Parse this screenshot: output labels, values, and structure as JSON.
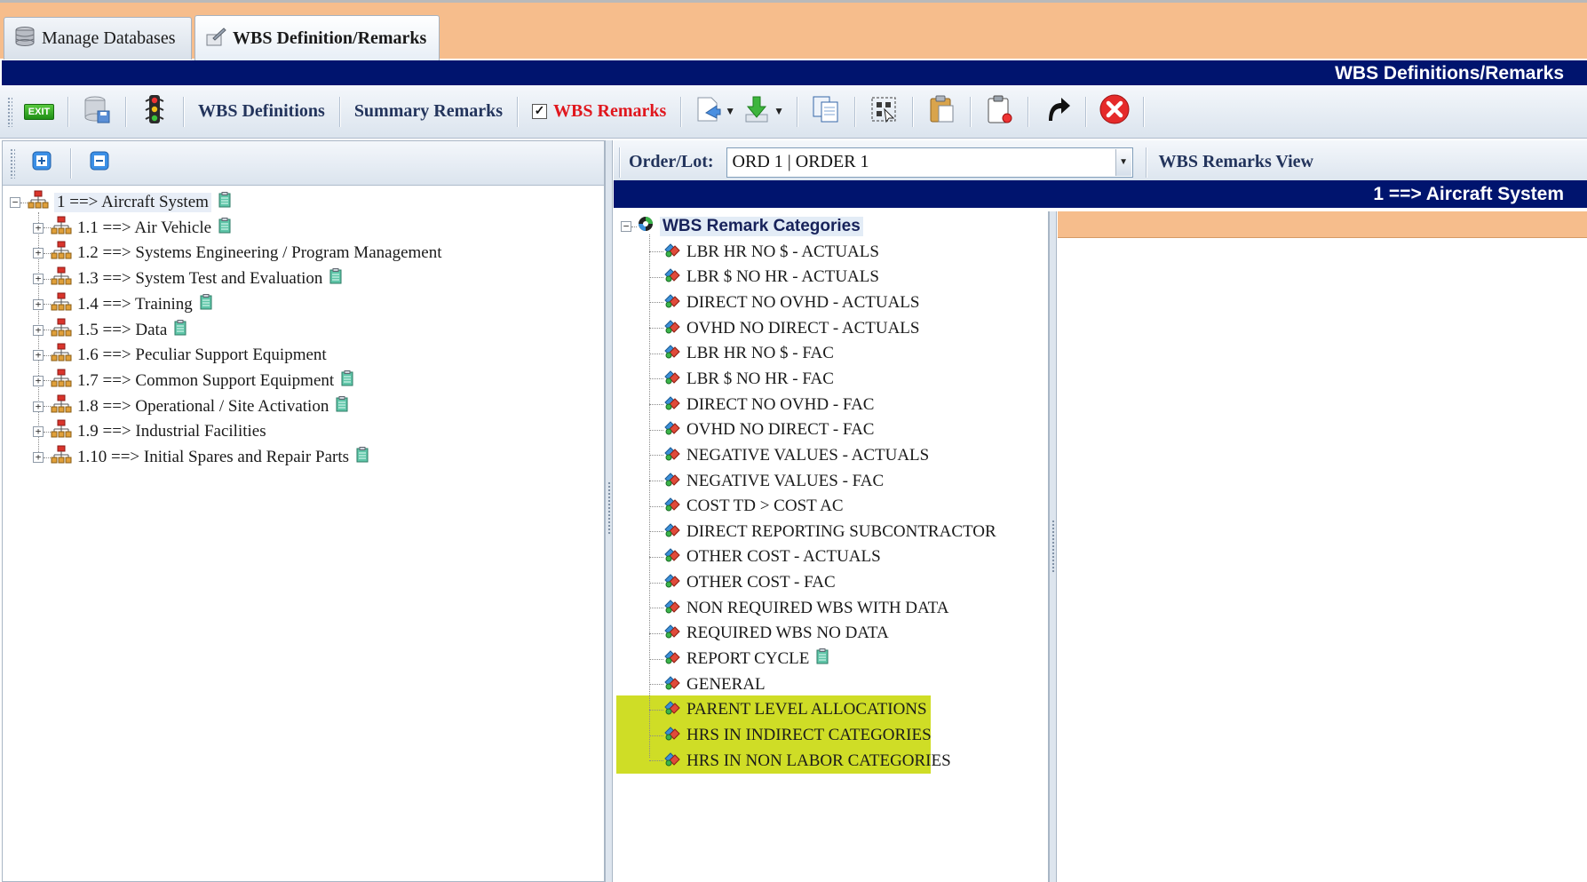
{
  "tabs": [
    {
      "label": "Manage Databases",
      "icon": "database-icon",
      "active": false
    },
    {
      "label": "WBS Definition/Remarks",
      "icon": "edit-document-icon",
      "active": true
    }
  ],
  "title_bar": "WBS Definitions/Remarks",
  "toolbar": {
    "exit_label": "EXIT",
    "wbs_definitions": "WBS Definitions",
    "summary_remarks": "Summary Remarks",
    "wbs_remarks": "WBS Remarks",
    "wbs_remarks_checked": true
  },
  "left_tree": {
    "root": {
      "label": "1 ==> Aircraft System",
      "has_note": true
    },
    "children": [
      {
        "label": "1.1 ==> Air Vehicle",
        "has_note": true
      },
      {
        "label": "1.2 ==> Systems Engineering / Program Management",
        "has_note": false
      },
      {
        "label": "1.3 ==> System Test and Evaluation",
        "has_note": true
      },
      {
        "label": "1.4 ==> Training",
        "has_note": true
      },
      {
        "label": "1.5 ==> Data",
        "has_note": true
      },
      {
        "label": "1.6 ==> Peculiar Support Equipment",
        "has_note": false
      },
      {
        "label": "1.7 ==> Common Support Equipment",
        "has_note": true
      },
      {
        "label": "1.8 ==> Operational / Site Activation",
        "has_note": true
      },
      {
        "label": "1.9 ==> Industrial Facilities",
        "has_note": false
      },
      {
        "label": "1.10 ==> Initial Spares and Repair Parts",
        "has_note": true
      }
    ]
  },
  "order_bar": {
    "label": "Order/Lot:",
    "value": "ORD 1 | ORDER 1",
    "view_label": "WBS Remarks View"
  },
  "selected_wbs": "1 ==> Aircraft System",
  "categories_tree": {
    "header": "WBS Remark Categories",
    "items": [
      {
        "label": "LBR HR NO $ - ACTUALS"
      },
      {
        "label": "LBR $ NO HR - ACTUALS"
      },
      {
        "label": "DIRECT NO OVHD - ACTUALS"
      },
      {
        "label": "OVHD NO DIRECT - ACTUALS"
      },
      {
        "label": "LBR HR NO $ - FAC"
      },
      {
        "label": "LBR $ NO HR - FAC"
      },
      {
        "label": "DIRECT NO OVHD - FAC"
      },
      {
        "label": "OVHD NO DIRECT - FAC"
      },
      {
        "label": "NEGATIVE VALUES - ACTUALS"
      },
      {
        "label": "NEGATIVE VALUES - FAC"
      },
      {
        "label": "COST TD > COST AC"
      },
      {
        "label": "DIRECT REPORTING SUBCONTRACTOR"
      },
      {
        "label": "OTHER COST - ACTUALS"
      },
      {
        "label": "OTHER COST - FAC"
      },
      {
        "label": "NON REQUIRED WBS WITH DATA"
      },
      {
        "label": "REQUIRED WBS NO DATA"
      },
      {
        "label": "REPORT CYCLE",
        "has_note": true
      },
      {
        "label": "GENERAL"
      },
      {
        "label": "PARENT LEVEL ALLOCATIONS",
        "highlighted": true
      },
      {
        "label": "HRS IN INDIRECT CATEGORIES",
        "highlighted": true
      },
      {
        "label": "HRS IN NON LABOR CATEGORIES",
        "highlighted": true
      }
    ]
  },
  "colors": {
    "tab_strip": "#f6bd8c",
    "navy": "#00146e",
    "highlight": "#cfdd26",
    "accent_red": "#e0161d"
  }
}
